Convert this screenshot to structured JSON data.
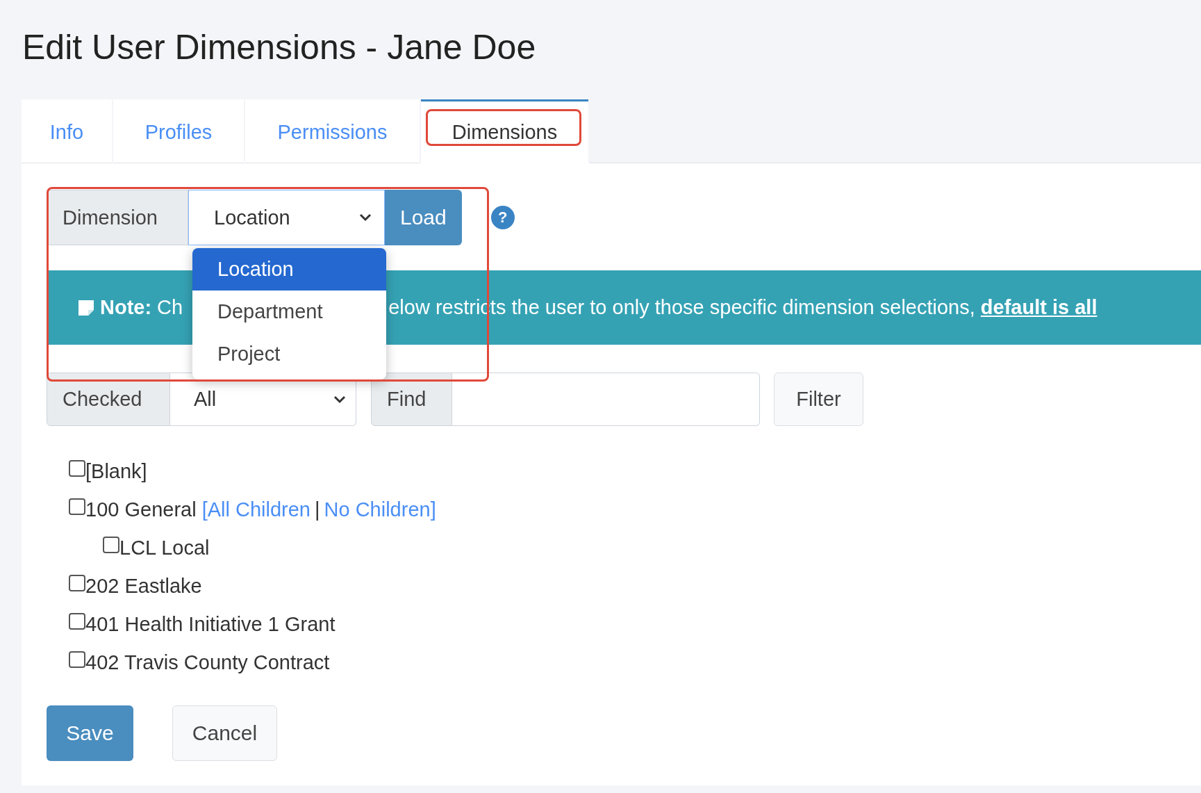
{
  "title": "Edit User Dimensions - Jane Doe",
  "tabs": [
    {
      "label": "Info",
      "selected": false,
      "highlighted": false
    },
    {
      "label": "Profiles",
      "selected": false,
      "highlighted": false
    },
    {
      "label": "Permissions",
      "selected": false,
      "highlighted": false
    },
    {
      "label": "Dimensions",
      "selected": true,
      "highlighted": true
    }
  ],
  "dimension_group": {
    "label": "Dimension",
    "value": "Location",
    "button": "Load",
    "help_glyph": "?",
    "highlighted": true,
    "dropdown": {
      "expanded": true,
      "options": [
        {
          "label": "Location",
          "selected": true
        },
        {
          "label": "Department",
          "selected": false
        },
        {
          "label": "Project",
          "selected": false
        }
      ]
    }
  },
  "note": {
    "label": "Note:",
    "text_before": "Ch",
    "text_after": "elow restricts the user to only those specific dimension selections, ",
    "link": "default is all"
  },
  "filter": {
    "checked_label": "Checked",
    "checked_value": "All",
    "find_label": "Find",
    "button": "Filter"
  },
  "tree": [
    {
      "label": "[Blank]",
      "checked": false
    },
    {
      "label": "100 General",
      "checked": false,
      "links": {
        "open": "[",
        "items": [
          "All Children",
          "No Children"
        ],
        "separator": "|",
        "close": "]"
      },
      "children": [
        {
          "label": "LCL Local",
          "checked": false
        }
      ]
    },
    {
      "label": "202 Eastlake",
      "checked": false
    },
    {
      "label": "401 Health Initiative 1 Grant",
      "checked": false
    },
    {
      "label": "402 Travis County Contract",
      "checked": false
    }
  ],
  "buttons": [
    {
      "label": "Save",
      "kind": "primary"
    },
    {
      "label": "Cancel",
      "kind": "secondary"
    }
  ]
}
